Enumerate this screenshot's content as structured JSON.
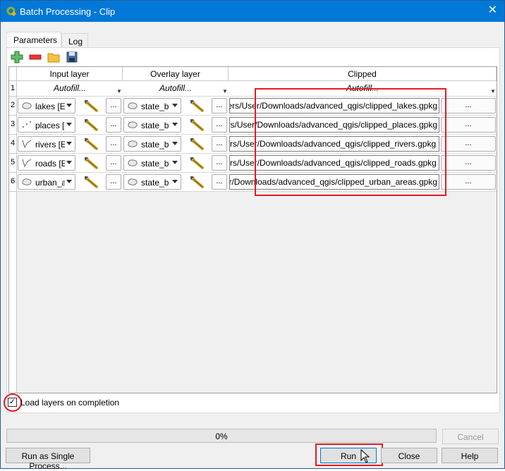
{
  "window": {
    "title": "Batch Processing - Clip",
    "close_glyph": "✕"
  },
  "tabs": [
    {
      "label": "Parameters"
    },
    {
      "label": "Log"
    }
  ],
  "toolbar": {
    "icons": [
      "add-row-icon",
      "remove-row-icon",
      "open-folder-icon",
      "save-icon"
    ]
  },
  "table": {
    "headers": [
      "Input layer",
      "Overlay layer",
      "Clipped"
    ],
    "autofill_label": "Autofill...",
    "dots_label": "...",
    "rows": [
      {
        "num": "1"
      },
      {
        "num": "2",
        "input": "lakes [E",
        "overlay": "state_b",
        "output": "ers/User/Downloads/advanced_qgis/clipped_lakes.gpkg",
        "input_icon": "polygon-icon"
      },
      {
        "num": "3",
        "input": "places [",
        "overlay": "state_b",
        "output": "rs/User/Downloads/advanced_qgis/clipped_places.gpkg",
        "input_icon": "point-icon"
      },
      {
        "num": "4",
        "input": "rivers [E",
        "overlay": "state_b",
        "output": "rs/User/Downloads/advanced_qgis/clipped_rivers.gpkg",
        "input_icon": "line-icon"
      },
      {
        "num": "5",
        "input": "roads [E",
        "overlay": "state_b",
        "output": "rs/User/Downloads/advanced_qgis/clipped_roads.gpkg",
        "input_icon": "line-icon"
      },
      {
        "num": "6",
        "input": "urban_a",
        "overlay": "state_b",
        "output": "r/Downloads/advanced_qgis/clipped_urban_areas.gpkg",
        "input_icon": "polygon-icon"
      }
    ]
  },
  "load_layers": {
    "label": "Load layers on completion",
    "checked": true,
    "check_glyph": "✓"
  },
  "progress": {
    "text": "0%",
    "value": 0
  },
  "buttons": {
    "cancel": "Cancel",
    "single": "Run as Single Process...",
    "run": "Run",
    "close": "Close",
    "help": "Help"
  },
  "colors": {
    "titlebar": "#0078d7",
    "highlight": "#e31b23"
  }
}
